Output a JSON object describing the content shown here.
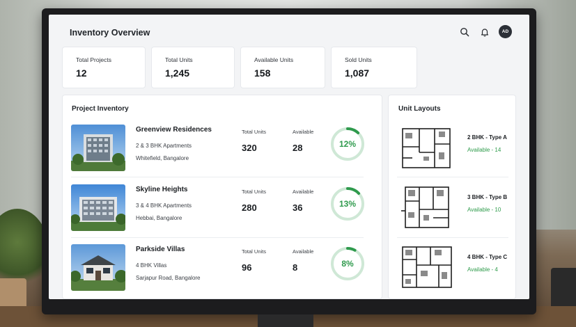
{
  "header": {
    "title": "Inventory Overview",
    "icons": [
      "search-icon",
      "bell-icon"
    ],
    "avatar_initials": "AD"
  },
  "stats": [
    {
      "label": "Total Projects",
      "value": "12"
    },
    {
      "label": "Total Units",
      "value": "1,245"
    },
    {
      "label": "Available Units",
      "value": "158"
    },
    {
      "label": "Sold Units",
      "value": "1,087"
    }
  ],
  "projects": {
    "title": "Project Inventory",
    "total_label": "Total Units",
    "available_label": "Available",
    "items": [
      {
        "name": "Greenview Residences",
        "type": "2 & 3 BHK Apartments",
        "location": "Whitefield, Bangalore",
        "total": "320",
        "available": "28",
        "percent_label": "12%",
        "percent": 12
      },
      {
        "name": "Skyline Heights",
        "type": "3 & 4 BHK Apartments",
        "location": "Hebbai, Bangalore",
        "total": "280",
        "available": "36",
        "percent_label": "13%",
        "percent": 13
      },
      {
        "name": "Parkside Villas",
        "type": "4 BHK Villas",
        "location": "Sarjapur Road, Bangalore",
        "total": "96",
        "available": "8",
        "percent_label": "8%",
        "percent": 8
      }
    ]
  },
  "layouts": {
    "title": "Unit Layouts",
    "items": [
      {
        "name": "2 BHK - Type A",
        "availability": "Available - 14"
      },
      {
        "name": "3 BHK - Type B",
        "availability": "Available - 10"
      },
      {
        "name": "4 BHK - Type C",
        "availability": "Available - 4"
      }
    ]
  },
  "colors": {
    "accent_green": "#2f9a4d",
    "ring_track": "#cfe8d6",
    "avatar_bg": "#2b2f36"
  }
}
